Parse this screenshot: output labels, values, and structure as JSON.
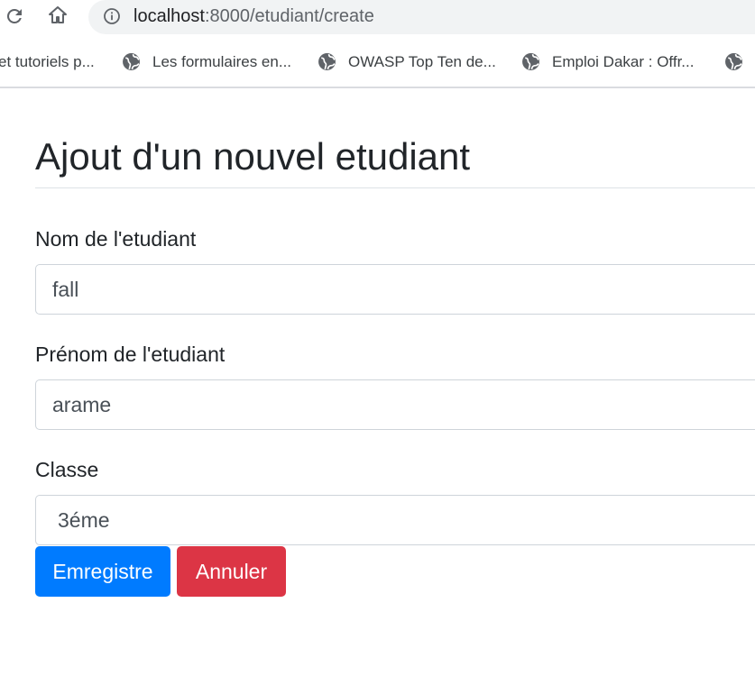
{
  "browser": {
    "url_host": "localhost",
    "url_path": ":8000/etudiant/create",
    "bookmarks": [
      {
        "label": "et tutoriels p..."
      },
      {
        "label": "Les formulaires en..."
      },
      {
        "label": "OWASP Top Ten de..."
      },
      {
        "label": "Emploi Dakar : Offr..."
      },
      {
        "label": ""
      }
    ]
  },
  "page": {
    "title": "Ajout d'un nouvel etudiant"
  },
  "form": {
    "nom": {
      "label": "Nom de l'etudiant",
      "value": "fall"
    },
    "prenom": {
      "label": "Prénom de l'etudiant",
      "value": "arame"
    },
    "classe": {
      "label": "Classe",
      "value": "3éme"
    },
    "submit_label": "Emregistre",
    "cancel_label": "Annuler"
  },
  "colors": {
    "primary": "#007bff",
    "danger": "#dc3545"
  }
}
